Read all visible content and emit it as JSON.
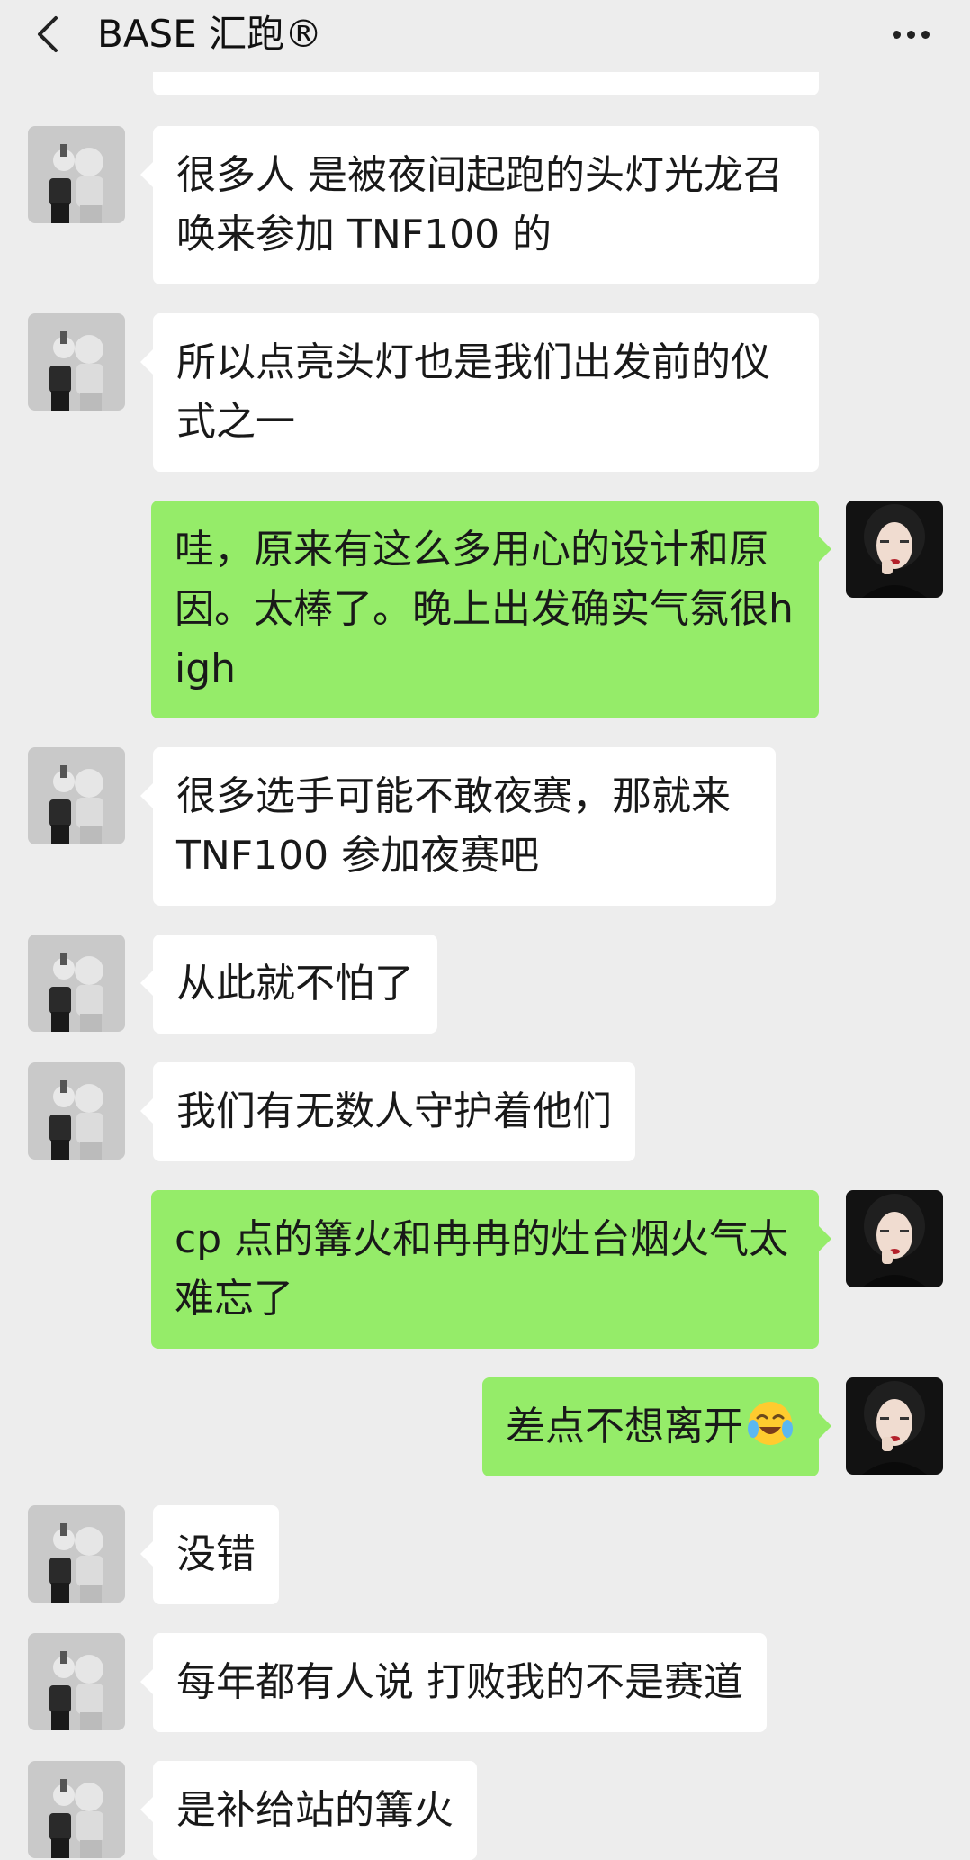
{
  "header": {
    "title": "BASE 汇跑®",
    "back_icon": "chevron-left-icon",
    "more_icon": "more-horizontal-icon"
  },
  "colors": {
    "background": "#ededed",
    "incoming_bubble": "#ffffff",
    "outgoing_bubble": "#95ec69",
    "text": "#191919"
  },
  "messages": [
    {
      "sender": "other",
      "text": "很多人 是被夜间起跑的头灯光龙召唤来参加 TNF100 的"
    },
    {
      "sender": "other",
      "text": "所以点亮头灯也是我们出发前的仪式之一"
    },
    {
      "sender": "me",
      "text": "哇，原来有这么多用心的设计和原因。太棒了。晚上出发确实气氛很high"
    },
    {
      "sender": "other",
      "text": "很多选手可能不敢夜赛，那就来TNF100 参加夜赛吧"
    },
    {
      "sender": "other",
      "text": "从此就不怕了"
    },
    {
      "sender": "other",
      "text": "我们有无数人守护着他们"
    },
    {
      "sender": "me",
      "text": "cp 点的篝火和冉冉的灶台烟火气太难忘了"
    },
    {
      "sender": "me",
      "text": "差点不想离开",
      "emoji": "crying-laughing-emoji"
    },
    {
      "sender": "other",
      "text": "没错"
    },
    {
      "sender": "other",
      "text": "每年都有人说 打败我的不是赛道"
    },
    {
      "sender": "other",
      "text": "是补给站的篝火"
    }
  ]
}
